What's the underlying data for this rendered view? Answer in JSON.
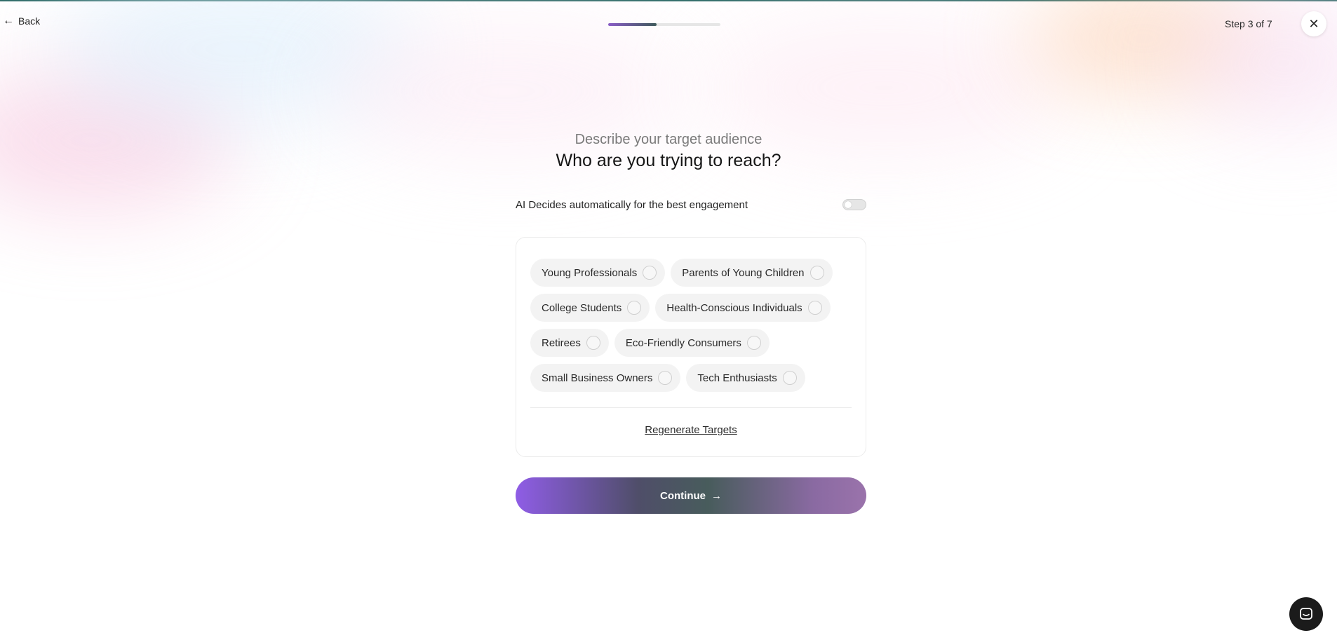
{
  "header": {
    "back_label": "Back",
    "step_label": "Step 3 of 7",
    "progress_fraction": 0.43
  },
  "heading": {
    "subtitle": "Describe your target audience",
    "title": "Who are you trying to reach?"
  },
  "ai_toggle": {
    "label": "AI Decides automatically for the best engagement",
    "enabled": false
  },
  "audiences": [
    {
      "label": "Young Professionals",
      "selected": false
    },
    {
      "label": "Parents of Young Children",
      "selected": false
    },
    {
      "label": "College Students",
      "selected": false
    },
    {
      "label": "Health-Conscious Individuals",
      "selected": false
    },
    {
      "label": "Retirees",
      "selected": false
    },
    {
      "label": "Eco-Friendly Consumers",
      "selected": false
    },
    {
      "label": "Small Business Owners",
      "selected": false
    },
    {
      "label": "Tech Enthusiasts",
      "selected": false
    }
  ],
  "regenerate_label": "Regenerate Targets",
  "continue_label": "Continue",
  "icons": {
    "back": "arrow-left-icon",
    "close": "close-icon",
    "continue": "arrow-right-icon",
    "chat": "chat-icon"
  },
  "colors": {
    "progress_start": "#8a5cc7",
    "progress_end": "#3e5a5a",
    "button_start": "#8f5de6",
    "button_mid": "#485c5c",
    "button_end": "#9a73ab"
  }
}
